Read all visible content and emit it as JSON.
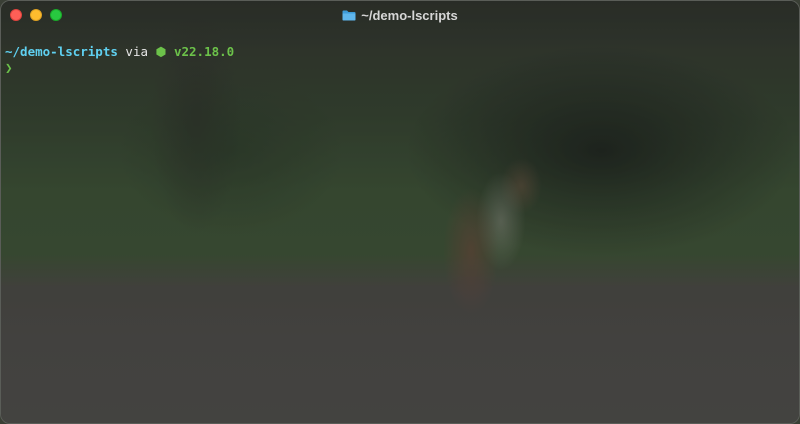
{
  "window": {
    "title": "~/demo-lscripts",
    "title_icon": "folder-icon"
  },
  "controls": {
    "close": "close-button",
    "minimize": "minimize-button",
    "maximize": "maximize-button"
  },
  "terminal": {
    "cwd": "~/demo-lscripts",
    "via": "via",
    "runtime_icon": "node-icon",
    "runtime_glyph": "⬢",
    "runtime_version": "v22.18.0",
    "prompt_symbol": "❯"
  },
  "colors": {
    "cwd": "#5fd0f0",
    "runtime": "#6cc24a",
    "close": "#fe5f57",
    "minimize": "#febc2e",
    "maximize": "#28c840"
  }
}
